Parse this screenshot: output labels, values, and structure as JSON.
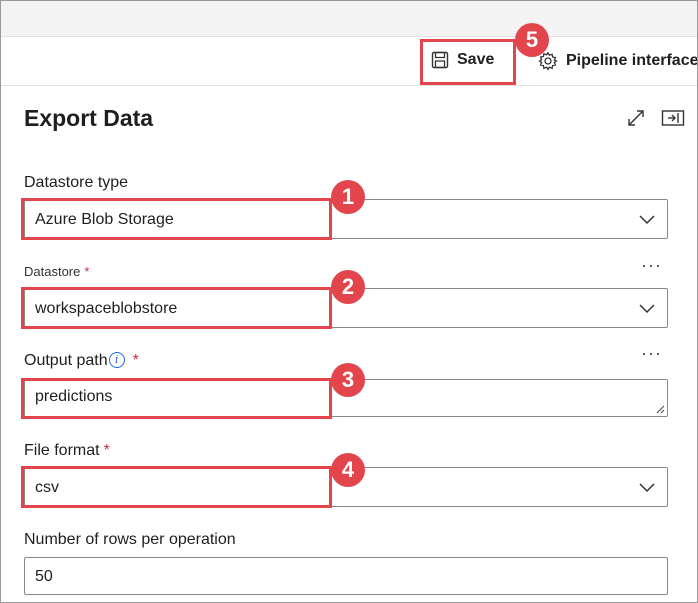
{
  "toolbar": {
    "save_label": "Save",
    "pipeline_label": "Pipeline interface"
  },
  "panel": {
    "title": "Export Data"
  },
  "form": {
    "datastore_type": {
      "label": "Datastore type",
      "value": "Azure Blob Storage"
    },
    "datastore": {
      "label": "Datastore",
      "required_mark": "*",
      "value": "workspaceblobstore",
      "more": "···"
    },
    "output_path": {
      "label": "Output path",
      "info": "i",
      "required_mark": "*",
      "value": "predictions",
      "more": "···"
    },
    "file_format": {
      "label": "File format",
      "required_mark": "*",
      "value": "csv"
    },
    "rows_per_operation": {
      "label": "Number of rows per operation",
      "value": "50"
    }
  },
  "annotations": [
    "1",
    "2",
    "3",
    "4",
    "5"
  ],
  "colors": {
    "highlight": "#e2464c",
    "info": "#1a6ed8",
    "required": "#c4314b"
  }
}
